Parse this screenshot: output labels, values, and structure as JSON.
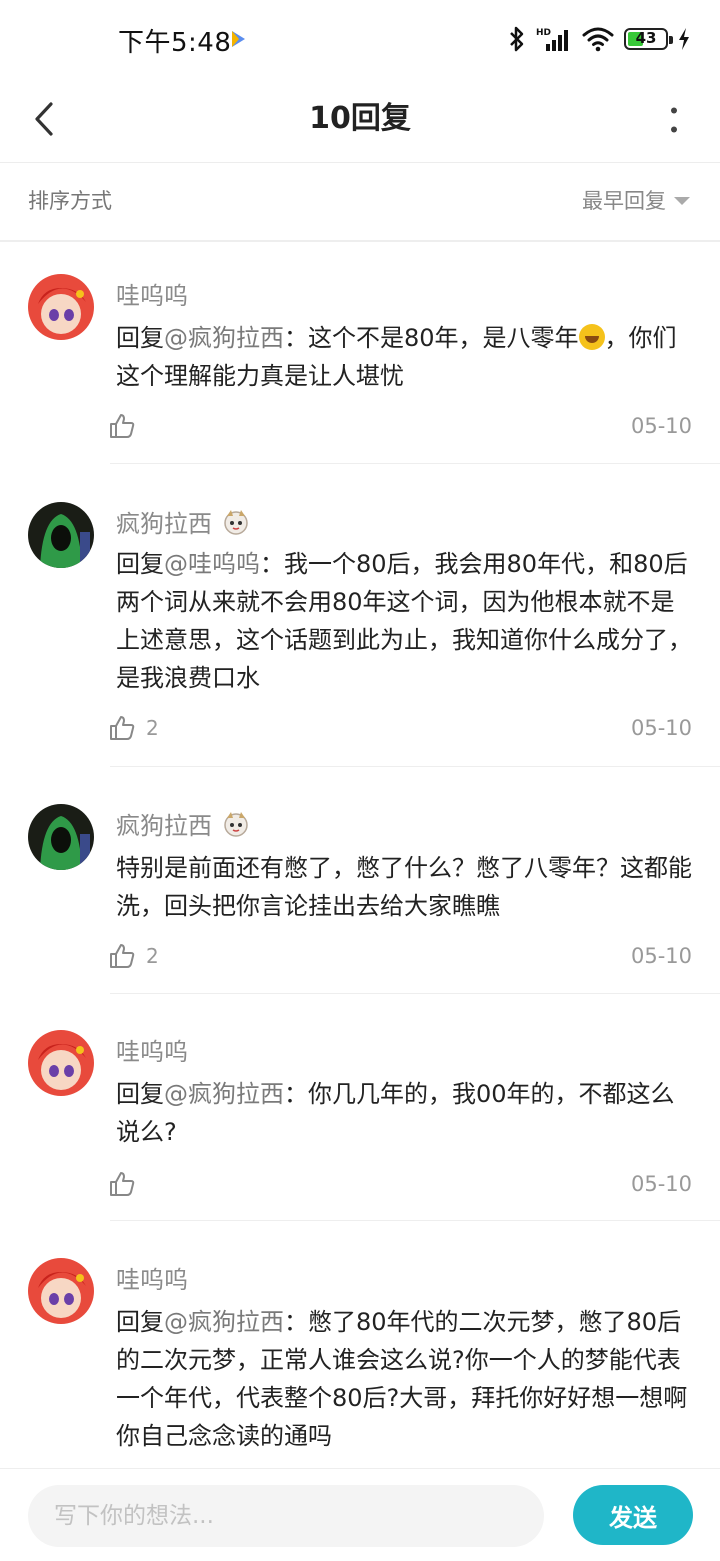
{
  "status_bar": {
    "time": "下午5:48",
    "battery": "43"
  },
  "header": {
    "title": "10回复"
  },
  "sort": {
    "label": "排序方式",
    "selected": "最早回复"
  },
  "replies": [
    {
      "user": "哇呜呜",
      "prefix": "回复",
      "mention": "@疯狗拉西",
      "sep": "：",
      "text_a": "这个不是80年，是八零年",
      "text_b": "，你们这个理解能力真是让人堪忧",
      "likes": "",
      "date": "05-10"
    },
    {
      "user": "疯狗拉西",
      "prefix": "回复",
      "mention": "@哇呜呜",
      "sep": "：",
      "text_a": "我一个80后，我会用80年代，和80后两个词从来就不会用80年这个词，因为他根本就不是上述意思，这个话题到此为止，我知道你什么成分了，是我浪费口水",
      "text_b": "",
      "likes": "2",
      "date": "05-10"
    },
    {
      "user": "疯狗拉西",
      "prefix": "",
      "mention": "",
      "sep": "",
      "text_a": "特别是前面还有憋了，憋了什么？憋了八零年？这都能洗，回头把你言论挂出去给大家瞧瞧",
      "text_b": "",
      "likes": "2",
      "date": "05-10"
    },
    {
      "user": "哇呜呜",
      "prefix": "回复",
      "mention": "@疯狗拉西",
      "sep": "：",
      "text_a": "你几几年的，我00年的，不都这么说么?",
      "text_b": "",
      "likes": "",
      "date": "05-10"
    },
    {
      "user": "哇呜呜",
      "prefix": "回复",
      "mention": "@疯狗拉西",
      "sep": "：",
      "text_a": "憋了80年代的二次元梦，憋了80后的二次元梦，正常人谁会这么说?你一个人的梦能代表一个年代，代表整个80后?大哥，拜托你好好想一想啊你自己念念读的通吗",
      "text_b": "",
      "likes": "",
      "date": ""
    }
  ],
  "composer": {
    "placeholder": "写下你的想法...",
    "send_label": "发送"
  },
  "colors": {
    "accent": "#1fb6c8",
    "battery": "#37c837"
  }
}
